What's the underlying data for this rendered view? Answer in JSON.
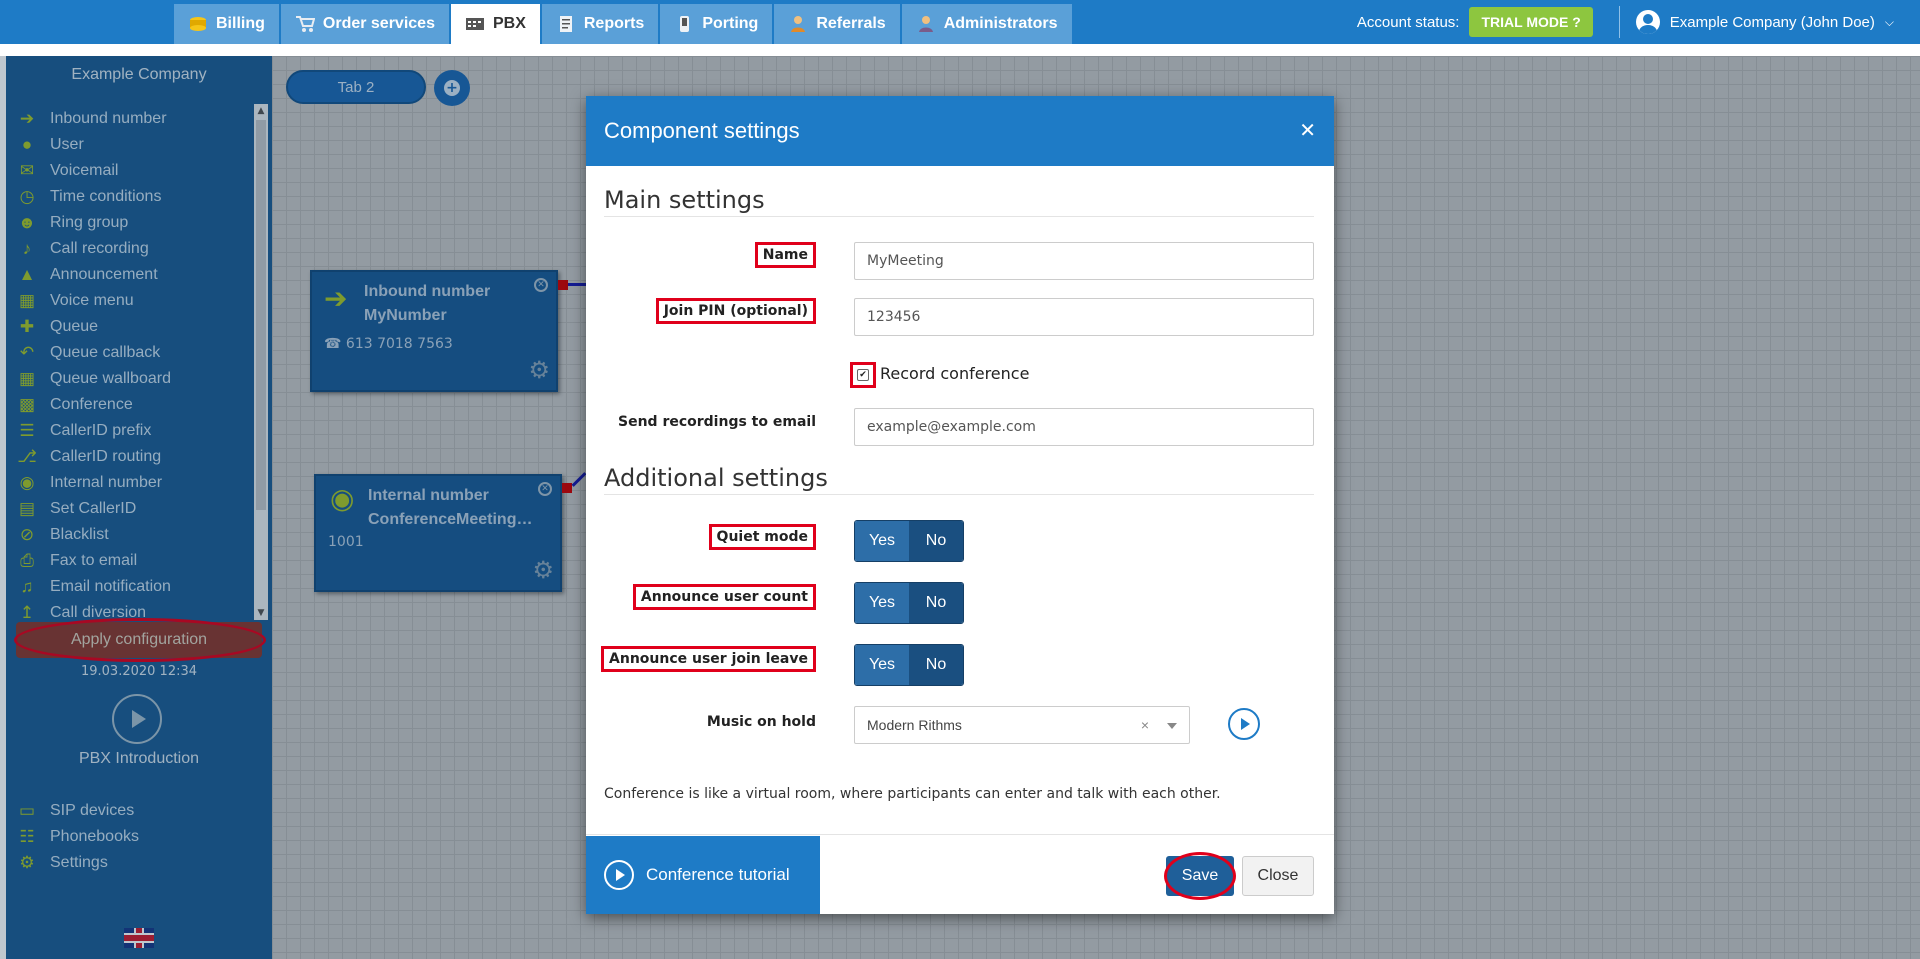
{
  "topnav": {
    "tabs": [
      {
        "label": "Billing",
        "icon": "coins-icon"
      },
      {
        "label": "Order services",
        "icon": "cart-icon"
      },
      {
        "label": "PBX",
        "icon": "pbx-icon",
        "active": true
      },
      {
        "label": "Reports",
        "icon": "report-icon"
      },
      {
        "label": "Porting",
        "icon": "phone-icon"
      },
      {
        "label": "Referrals",
        "icon": "referral-icon"
      },
      {
        "label": "Administrators",
        "icon": "admin-icon"
      }
    ],
    "account_status_label": "Account status:",
    "trial_badge": "TRIAL MODE",
    "user_label": "Example Company (John Doe)"
  },
  "sidebar": {
    "company": "Example Company",
    "items": [
      {
        "label": "Inbound number",
        "icon": "arrow-right-icon"
      },
      {
        "label": "User",
        "icon": "user-icon"
      },
      {
        "label": "Voicemail",
        "icon": "envelope-icon"
      },
      {
        "label": "Time conditions",
        "icon": "clock-icon"
      },
      {
        "label": "Ring group",
        "icon": "users-icon"
      },
      {
        "label": "Call recording",
        "icon": "microphone-icon"
      },
      {
        "label": "Announcement",
        "icon": "megaphone-icon"
      },
      {
        "label": "Voice menu",
        "icon": "grid-icon"
      },
      {
        "label": "Queue",
        "icon": "user-plus-icon"
      },
      {
        "label": "Queue callback",
        "icon": "reply-icon"
      },
      {
        "label": "Queue wallboard",
        "icon": "table-icon"
      },
      {
        "label": "Conference",
        "icon": "chat-icon"
      },
      {
        "label": "CallerID prefix",
        "icon": "list-icon"
      },
      {
        "label": "CallerID routing",
        "icon": "sitemap-icon"
      },
      {
        "label": "Internal number",
        "icon": "map-marker-icon"
      },
      {
        "label": "Set CallerID",
        "icon": "id-card-icon"
      },
      {
        "label": "Blacklist",
        "icon": "ban-icon"
      },
      {
        "label": "Fax to email",
        "icon": "fax-icon"
      },
      {
        "label": "Email notification",
        "icon": "bell-icon"
      },
      {
        "label": "Call diversion",
        "icon": "diversion-icon"
      }
    ],
    "apply_label": "Apply configuration",
    "apply_date": "19.03.2020 12:34",
    "intro_label": "PBX Introduction",
    "bottom_items": [
      {
        "label": "SIP devices",
        "icon": "monitor-icon"
      },
      {
        "label": "Phonebooks",
        "icon": "book-icon"
      },
      {
        "label": "Settings",
        "icon": "gear-icon"
      }
    ]
  },
  "canvas": {
    "tab_label": "Tab 2",
    "nodes": [
      {
        "title1": "Inbound number",
        "title2": "MyNumber",
        "sub": "613 7018 7563"
      },
      {
        "title1": "Internal number",
        "title2": "ConferenceMeeting…",
        "sub": "1001"
      }
    ]
  },
  "modal": {
    "title": "Component settings",
    "main_section": "Main settings",
    "name_label": "Name",
    "name_value": "MyMeeting",
    "pin_label": "Join PIN (optional)",
    "pin_value": "123456",
    "record_label": "Record conference",
    "email_label": "Send recordings to email",
    "email_placeholder": "example@example.com",
    "additional_section": "Additional settings",
    "quiet_label": "Quiet mode",
    "announce_count_label": "Announce user count",
    "announce_join_label": "Announce user join leave",
    "yes": "Yes",
    "no": "No",
    "moh_label": "Music on hold",
    "moh_value": "Modern Rithms",
    "description": "Conference is like a virtual room, where participants can enter and talk with each other.",
    "tutorial_label": "Conference tutorial",
    "save_label": "Save",
    "close_label": "Close"
  },
  "colors": {
    "accent": "#1e7bc6",
    "sidebar": "#1f5e94",
    "highlight": "#e0001b",
    "trial": "#8dc63f"
  }
}
